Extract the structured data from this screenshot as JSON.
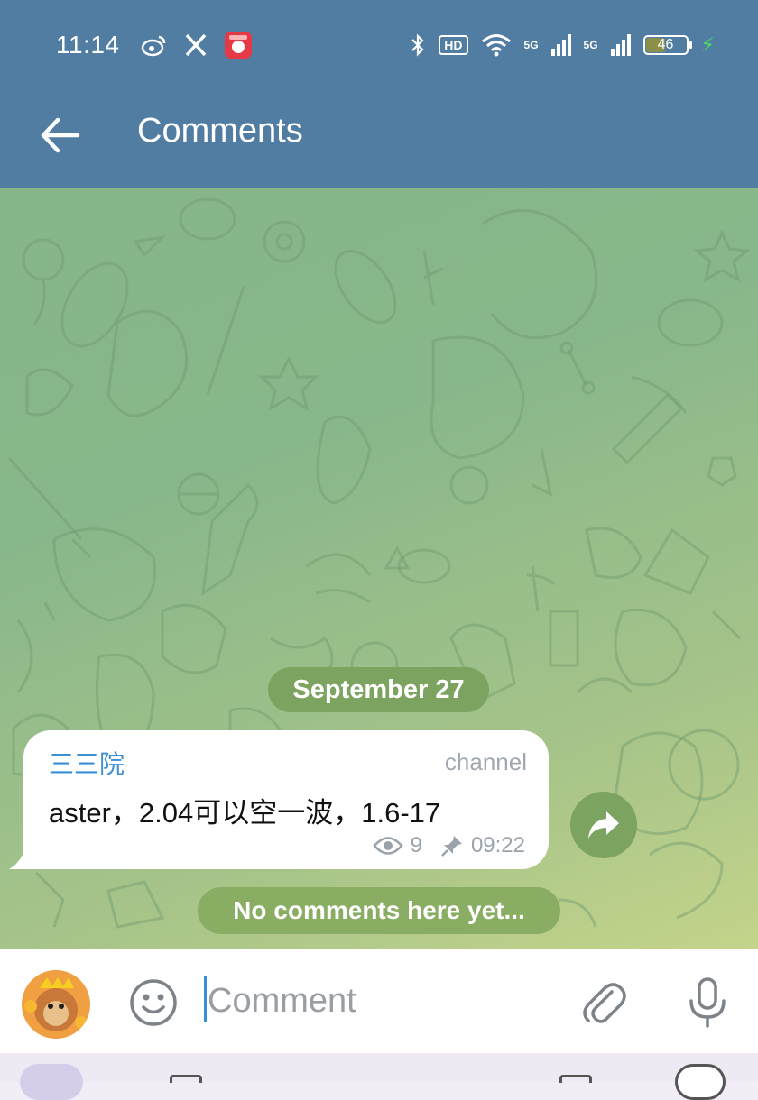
{
  "status_bar": {
    "time": "11:14",
    "left_icons": [
      "weibo-icon",
      "x-icon",
      "app-icon"
    ],
    "hd_label": "HD",
    "net1": "5G",
    "net2": "5G",
    "battery": "46",
    "battery_level": 0.46,
    "right_icons": [
      "bluetooth-icon",
      "wifi-icon",
      "signal-icon",
      "battery-icon",
      "charging-icon"
    ]
  },
  "header": {
    "title": "Comments",
    "back_icon": "arrow-left-icon"
  },
  "chat": {
    "date": "September 27",
    "message": {
      "author": "三三院",
      "tag": "channel",
      "text": "aster，2.04可以空一波，1.6-17",
      "views": "9",
      "time": "09:22"
    },
    "empty_state": "No comments here yet..."
  },
  "input": {
    "placeholder": "Comment",
    "value": ""
  },
  "colors": {
    "header": "#517da2",
    "accent_green": "#7ca35f",
    "author_blue": "#3a8fd5"
  }
}
